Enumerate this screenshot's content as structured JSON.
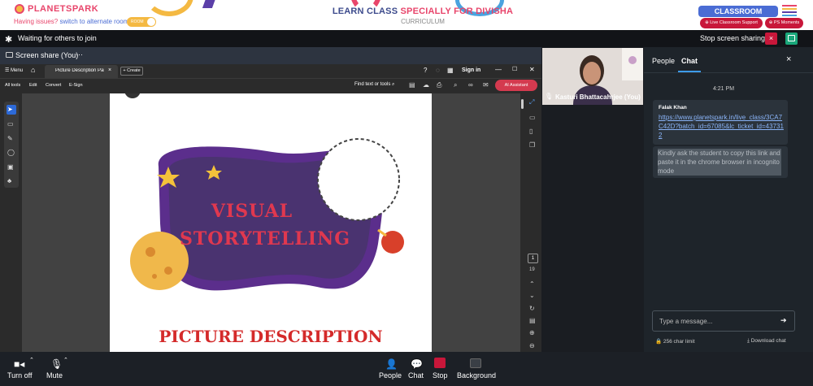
{
  "site": {
    "logo": "PLANETSPARK",
    "issues_text": "Having issues?",
    "alternate_link": "switch to alternate room",
    "room_toggle": "ROOM",
    "title_part1": "LEARN CLASS ",
    "title_part2": "SPECIALLY FOR DIVISHA",
    "subtitle": "CURRICULUM",
    "classroom_button": "CLASSROOM",
    "live_support": "Live Classroom Support",
    "ps_moments": "PS Moments",
    "colors": {
      "brand_pink": "#e8456b",
      "brand_blue": "#4a6cd4",
      "accent_yellow": "#f4b942",
      "support_red": "#c8173a"
    }
  },
  "meeting": {
    "status": "Waiting for others to join",
    "stop_sharing": "Stop screen sharing",
    "close_icon": "×",
    "screen_share_label": "Screen share (You)",
    "more": "···"
  },
  "browser": {
    "menu": "☰ Menu",
    "tab_title": "Picture Description Part ...",
    "tab_close": "×",
    "create": "+ Create",
    "sign_in": "Sign in",
    "toolbar": [
      "All tools",
      "Edit",
      "Convert",
      "E-Sign"
    ],
    "find": "Find text or tools",
    "ai_assistant": "AI Assistant",
    "page_current": "1",
    "page_total": "19"
  },
  "slide": {
    "line1": "VISUAL",
    "line2": "STORYTELLING",
    "footer": "PICTURE DESCRIPTION"
  },
  "video": {
    "participant": "Kasturi Bhattacahrjee (You)"
  },
  "chat": {
    "tabs": {
      "people": "People",
      "chat": "Chat"
    },
    "close": "×",
    "time": "4:21 PM",
    "messages": [
      {
        "sender": "Falak Khan",
        "text": "https://www.planetspark.in/live_class/3CA7C42D?batch_id=67085&lc_ticket_id=437312"
      },
      {
        "sender": "",
        "text": "Kindly ask the student to copy this link and paste it in the chrome browser in incognito mode"
      }
    ],
    "input_placeholder": "Type a message...",
    "send": "➔",
    "char_limit": "256 char limit",
    "download": "Download chat"
  },
  "controls": {
    "turn_off": "Turn off",
    "mute": "Mute",
    "people": "People",
    "chat": "Chat",
    "stop": "Stop",
    "background": "Background"
  }
}
